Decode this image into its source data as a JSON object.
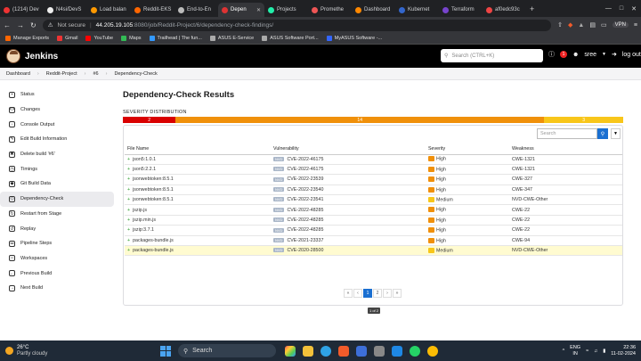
{
  "browser": {
    "tabs": [
      {
        "label": "(1214) Dev",
        "color": "#e33"
      },
      {
        "label": "N4si/DevS",
        "color": "#eee"
      },
      {
        "label": "Load balan",
        "color": "#f90"
      },
      {
        "label": "Reddit-EKS",
        "color": "#f60"
      },
      {
        "label": "End-to-En",
        "color": "#bbb"
      },
      {
        "label": "Depen",
        "color": "#d33",
        "active": true
      },
      {
        "label": "Projects",
        "color": "#2ea"
      },
      {
        "label": "Promethe",
        "color": "#e55"
      },
      {
        "label": "Dashboard",
        "color": "#f80"
      },
      {
        "label": "Kubernet",
        "color": "#36c"
      },
      {
        "label": "Terraform",
        "color": "#74c"
      },
      {
        "label": "af0edc93c",
        "color": "#e44"
      }
    ],
    "new_tab": "+",
    "address": {
      "security": "Not secure",
      "host": "44.205.19.105",
      "path": ":8080/job/Reddit-Project/6/dependency-check-findings/"
    },
    "vpn_label": "VPN",
    "bookmarks": [
      {
        "label": "Manage Exports",
        "color": "#f60"
      },
      {
        "label": "Gmail",
        "color": "#e33"
      },
      {
        "label": "YouTube",
        "color": "#f00"
      },
      {
        "label": "Maps",
        "color": "#3b5"
      },
      {
        "label": "Trailhead | The fun...",
        "color": "#39f"
      },
      {
        "label": "ASUS E-Service",
        "color": "#aaa"
      },
      {
        "label": "ASUS Software Port...",
        "color": "#aaa"
      },
      {
        "label": "MyASUS Software -...",
        "color": "#36f"
      }
    ]
  },
  "jenkins": {
    "brand": "Jenkins",
    "search_placeholder": "Search (CTRL+K)",
    "notification_count": "1",
    "user": "sree",
    "logout": "log out"
  },
  "breadcrumbs": [
    "Dashboard",
    "Reddit-Project",
    "#6",
    "Dependency-Check"
  ],
  "sidebar": [
    {
      "label": "Status",
      "icon": "status-icon"
    },
    {
      "label": "Changes",
      "icon": "code-icon"
    },
    {
      "label": "Console Output",
      "icon": "terminal-icon"
    },
    {
      "label": "Edit Build Information",
      "icon": "edit-icon"
    },
    {
      "label": "Delete build '#6'",
      "icon": "trash-icon"
    },
    {
      "label": "Timings",
      "icon": "clock-icon"
    },
    {
      "label": "Git Build Data",
      "icon": "git-icon"
    },
    {
      "label": "Dependency-Check",
      "icon": "shield-icon",
      "active": true
    },
    {
      "label": "Restart from Stage",
      "icon": "restart-icon"
    },
    {
      "label": "Replay",
      "icon": "replay-icon"
    },
    {
      "label": "Pipeline Steps",
      "icon": "steps-icon"
    },
    {
      "label": "Workspaces",
      "icon": "folder-icon"
    },
    {
      "label": "Previous Build",
      "icon": "arrow-left-icon"
    },
    {
      "label": "Next Build",
      "icon": "arrow-right-icon"
    }
  ],
  "main": {
    "title": "Dependency-Check Results",
    "severity_label": "SEVERITY DISTRIBUTION",
    "severity_distribution": [
      {
        "label": "2",
        "count": 2,
        "color": "#d90000"
      },
      {
        "label": "14",
        "count": 14,
        "color": "#f0900a"
      },
      {
        "label": "3",
        "count": 3,
        "color": "#f8c61a"
      }
    ],
    "table_search_placeholder": "Search",
    "columns": [
      "File Name",
      "Vulnerability",
      "Severity",
      "Weakness"
    ],
    "rows": [
      {
        "file": "json5:1.0.1",
        "tag": "NVD",
        "cve": "CVE-2022-46175",
        "severity": "High",
        "sevcolor": "#f0900a",
        "weakness": "CWE-1321"
      },
      {
        "file": "json5:2.2.1",
        "tag": "NVD",
        "cve": "CVE-2022-46175",
        "severity": "High",
        "sevcolor": "#f0900a",
        "weakness": "CWE-1321"
      },
      {
        "file": "jsonwebtoken:8.5.1",
        "tag": "NVD",
        "cve": "CVE-2022-23539",
        "severity": "High",
        "sevcolor": "#f0900a",
        "weakness": "CWE-327"
      },
      {
        "file": "jsonwebtoken:8.5.1",
        "tag": "NVD",
        "cve": "CVE-2022-23540",
        "severity": "High",
        "sevcolor": "#f0900a",
        "weakness": "CWE-347"
      },
      {
        "file": "jsonwebtoken:8.5.1",
        "tag": "NVD",
        "cve": "CVE-2022-23541",
        "severity": "Medium",
        "sevcolor": "#f8c61a",
        "weakness": "NVD-CWE-Other"
      },
      {
        "file": "jszip.js",
        "tag": "NVD",
        "cve": "CVE-2022-48285",
        "severity": "High",
        "sevcolor": "#f0900a",
        "weakness": "CWE-22"
      },
      {
        "file": "jszip.min.js",
        "tag": "NVD",
        "cve": "CVE-2022-48285",
        "severity": "High",
        "sevcolor": "#f0900a",
        "weakness": "CWE-22"
      },
      {
        "file": "jszip:3.7.1",
        "tag": "NVD",
        "cve": "CVE-2022-48285",
        "severity": "High",
        "sevcolor": "#f0900a",
        "weakness": "CWE-22"
      },
      {
        "file": "packages-bundle.js",
        "tag": "NVD",
        "cve": "CVE-2021-23337",
        "severity": "High",
        "sevcolor": "#f0900a",
        "weakness": "CWE-94"
      },
      {
        "file": "packages-bundle.js",
        "tag": "NVD",
        "cve": "CVE-2020-28500",
        "severity": "Medium",
        "sevcolor": "#f8c61a",
        "weakness": "NVD-CWE-Other",
        "highlight": true
      }
    ],
    "pagination": {
      "first": "«",
      "prev": "‹",
      "pages": [
        "1",
        "2"
      ],
      "current": "1",
      "next": "›",
      "last": "»"
    },
    "page_info": "1 of 2"
  },
  "taskbar": {
    "temperature": "26°C",
    "weather": "Partly cloudy",
    "search_label": "Search",
    "lang_top": "ENG",
    "lang_bottom": "IN",
    "time": "22:36",
    "date": "11-02-2024"
  }
}
